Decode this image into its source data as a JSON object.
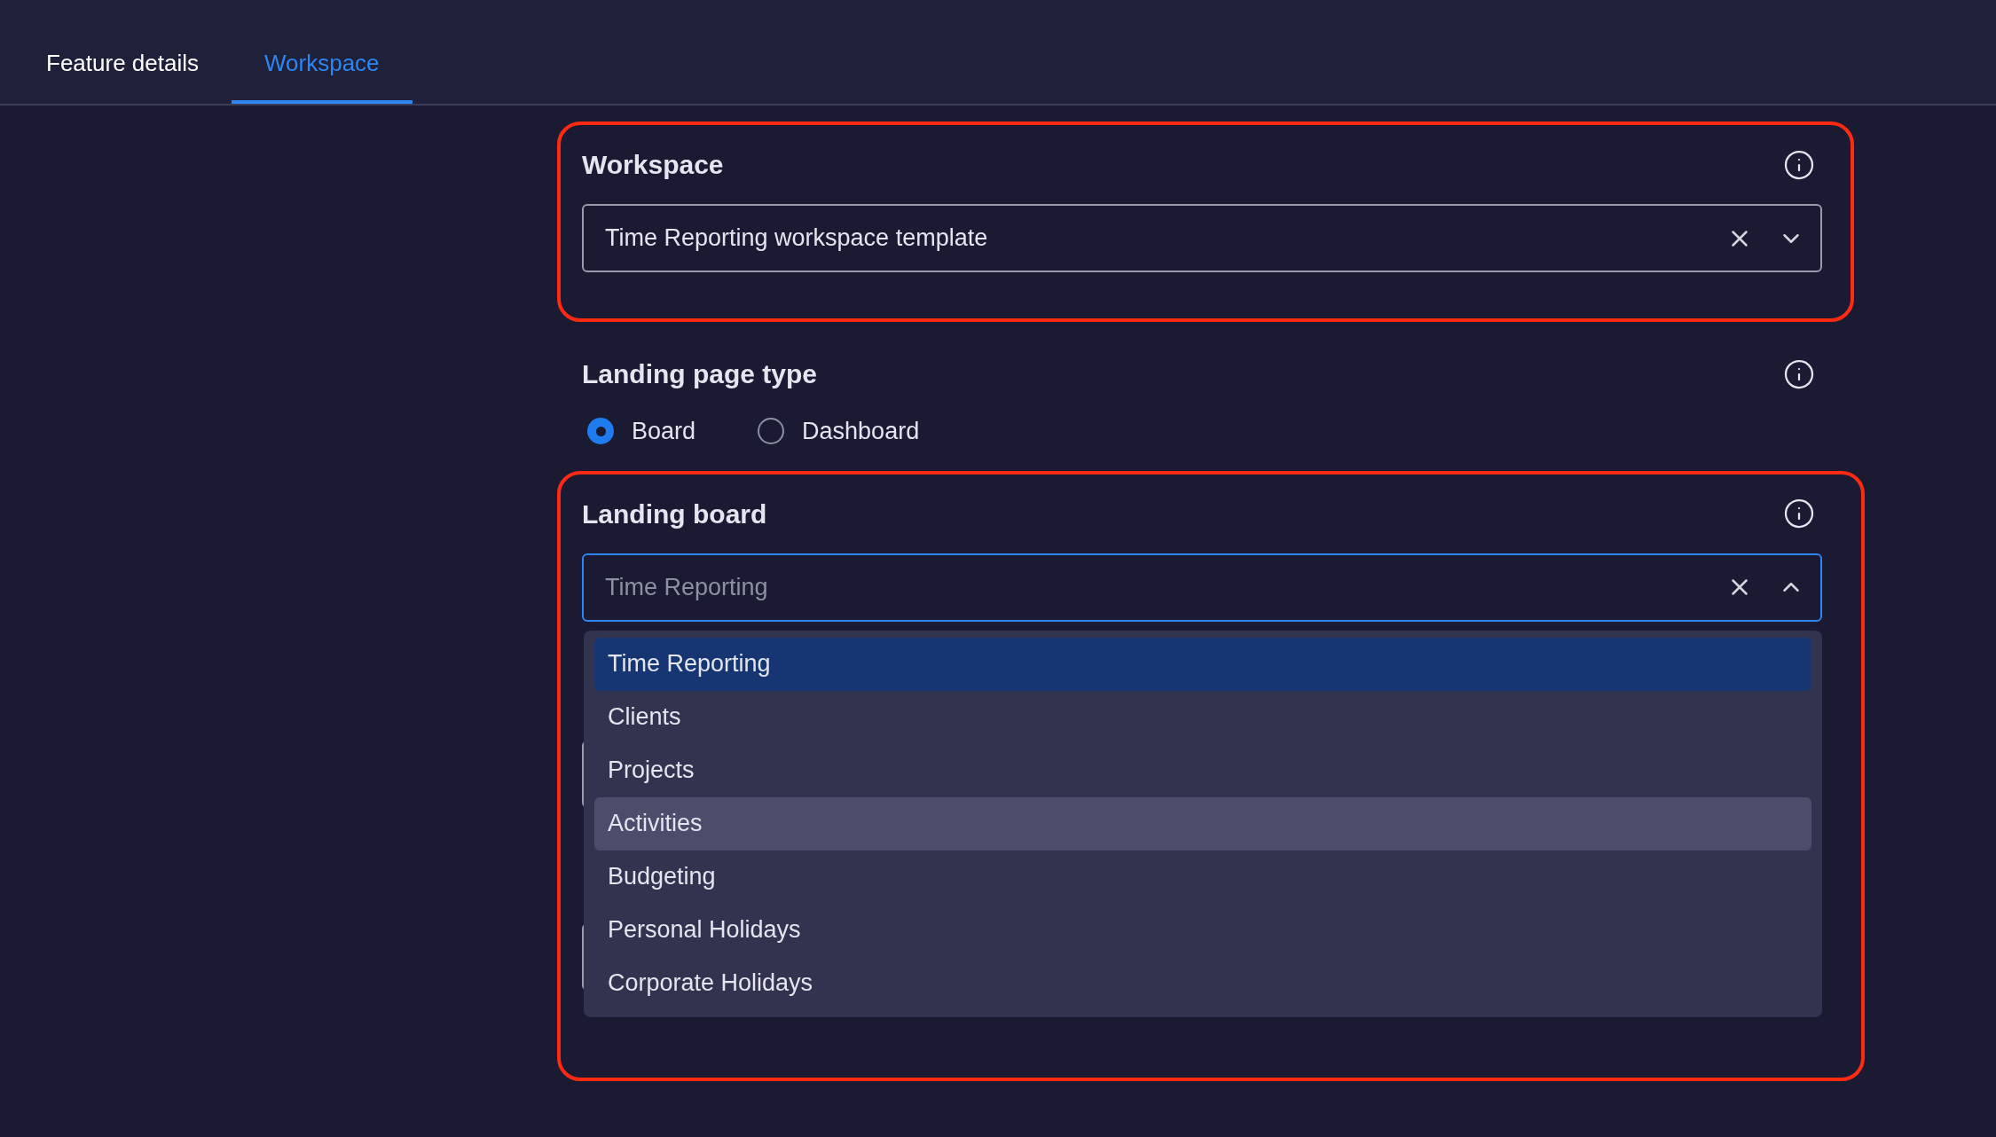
{
  "tabs": [
    {
      "label": "Feature details",
      "selected": false
    },
    {
      "label": "Workspace",
      "selected": true
    }
  ],
  "workspace": {
    "label": "Workspace",
    "value": "Time Reporting workspace template",
    "expanded": false
  },
  "landing_page_type": {
    "label": "Landing page type",
    "options": [
      {
        "label": "Board",
        "selected": true
      },
      {
        "label": "Dashboard",
        "selected": false
      }
    ]
  },
  "landing_board": {
    "label": "Landing board",
    "placeholder": "Time Reporting",
    "expanded": true,
    "options": [
      {
        "label": "Time Reporting",
        "selected": true,
        "hovered": false
      },
      {
        "label": "Clients",
        "selected": false,
        "hovered": false
      },
      {
        "label": "Projects",
        "selected": false,
        "hovered": false
      },
      {
        "label": "Activities",
        "selected": false,
        "hovered": true
      },
      {
        "label": "Budgeting",
        "selected": false,
        "hovered": false
      },
      {
        "label": "Personal Holidays",
        "selected": false,
        "hovered": false
      },
      {
        "label": "Corporate Holidays",
        "selected": false,
        "hovered": false
      }
    ]
  }
}
